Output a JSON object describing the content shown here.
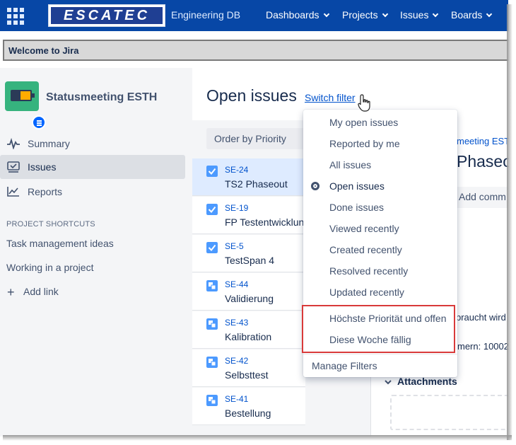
{
  "nav": {
    "logo_text": "ESCATEC",
    "title": "Engineering DB",
    "items": [
      "Dashboards",
      "Projects",
      "Issues",
      "Boards"
    ]
  },
  "banner": {
    "text": "Welcome to Jira"
  },
  "sidebar": {
    "project_name": "Statusmeeting ESTH",
    "items": [
      {
        "label": "Summary",
        "icon": "pulse-icon"
      },
      {
        "label": "Issues",
        "icon": "issues-icon",
        "active": true
      },
      {
        "label": "Reports",
        "icon": "chart-icon"
      }
    ],
    "shortcuts_heading": "PROJECT SHORTCUTS",
    "shortcuts": [
      "Task management ideas",
      "Working in a project"
    ],
    "add_link": "Add link"
  },
  "main": {
    "title": "Open issues",
    "switch_filter": "Switch filter",
    "order_by": "Order by Priority",
    "issues": [
      {
        "key": "SE-24",
        "title": "TS2 Phaseout",
        "type": "task"
      },
      {
        "key": "SE-19",
        "title": "FP Testentwicklung",
        "type": "task"
      },
      {
        "key": "SE-5",
        "title": "TestSpan 4",
        "type": "task"
      },
      {
        "key": "SE-44",
        "title": "Validierung",
        "type": "subtask"
      },
      {
        "key": "SE-43",
        "title": "Kalibration",
        "type": "subtask"
      },
      {
        "key": "SE-42",
        "title": "Selbsttest",
        "type": "subtask"
      },
      {
        "key": "SE-41",
        "title": "Bestellung",
        "type": "subtask"
      }
    ]
  },
  "detail": {
    "breadcrumb": "meeting ESTH",
    "title": "Phaseo",
    "add_comment": "Add comm",
    "text_1": "braucht wird",
    "text_2": "mern: 10002",
    "attachments": "Attachments"
  },
  "filter_menu": {
    "items": [
      "My open issues",
      "Reported by me",
      "All issues",
      "Open issues",
      "Done issues",
      "Viewed recently",
      "Created recently",
      "Resolved recently",
      "Updated recently",
      "Höchste Priorität und offen",
      "Diese Woche fällig"
    ],
    "selected": "Open issues",
    "manage": "Manage Filters"
  },
  "colors": {
    "nav_bg": "#0747a6",
    "link": "#0052cc",
    "highlight_border": "#d93a3a",
    "selected_row": "#deebff"
  }
}
